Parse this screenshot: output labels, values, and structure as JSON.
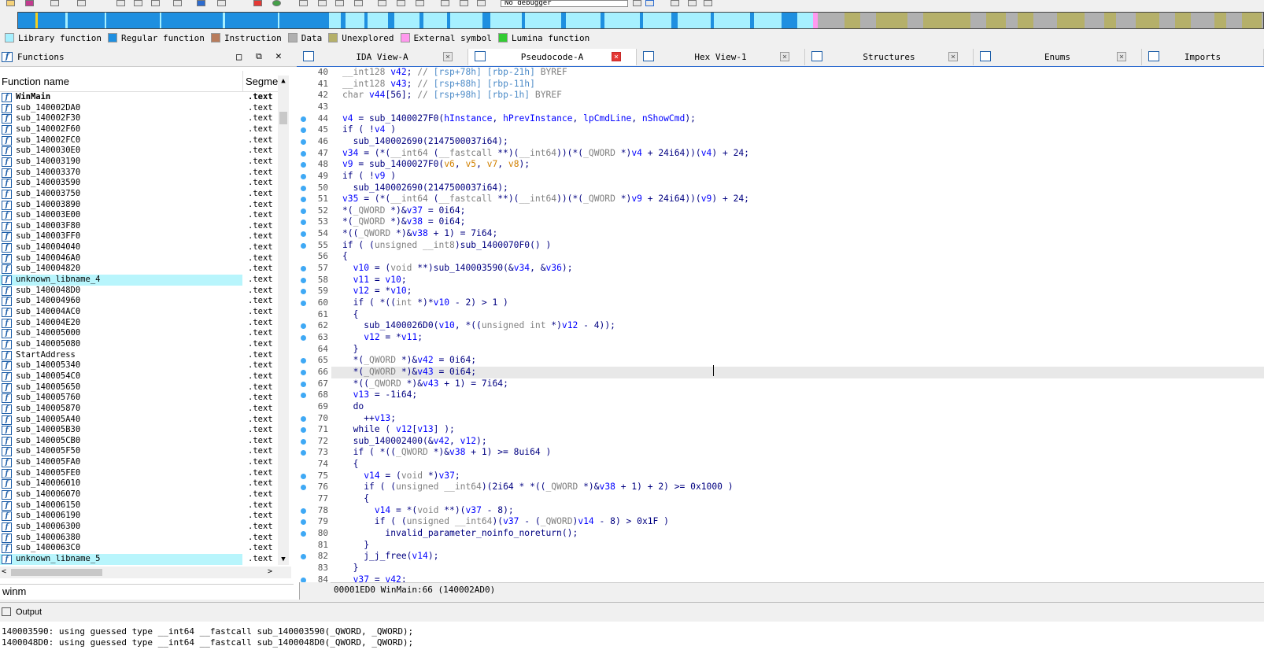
{
  "toolbar": {
    "debugger_select": "No debugger"
  },
  "legend": [
    {
      "label": "Library function",
      "color": "#a6f0ff"
    },
    {
      "label": "Regular function",
      "color": "#1e8fe0"
    },
    {
      "label": "Instruction",
      "color": "#b87c5c"
    },
    {
      "label": "Data",
      "color": "#b0b0b0"
    },
    {
      "label": "Unexplored",
      "color": "#b5b06a"
    },
    {
      "label": "External symbol",
      "color": "#ff99ee"
    },
    {
      "label": "Lumina function",
      "color": "#33cc33"
    }
  ],
  "functions_panel": {
    "title": "Functions",
    "col_name": "Function name",
    "col_segment": "Segme",
    "rows": [
      {
        "name": "WinMain",
        "seg": ".text",
        "bold": true
      },
      {
        "name": "sub_140002DA0",
        "seg": ".text"
      },
      {
        "name": "sub_140002F30",
        "seg": ".text"
      },
      {
        "name": "sub_140002F60",
        "seg": ".text"
      },
      {
        "name": "sub_140002FC0",
        "seg": ".text"
      },
      {
        "name": "sub_1400030E0",
        "seg": ".text"
      },
      {
        "name": "sub_140003190",
        "seg": ".text"
      },
      {
        "name": "sub_140003370",
        "seg": ".text"
      },
      {
        "name": "sub_140003590",
        "seg": ".text"
      },
      {
        "name": "sub_140003750",
        "seg": ".text"
      },
      {
        "name": "sub_140003890",
        "seg": ".text"
      },
      {
        "name": "sub_140003E00",
        "seg": ".text"
      },
      {
        "name": "sub_140003F80",
        "seg": ".text"
      },
      {
        "name": "sub_140003FF0",
        "seg": ".text"
      },
      {
        "name": "sub_140004040",
        "seg": ".text"
      },
      {
        "name": "sub_1400046A0",
        "seg": ".text"
      },
      {
        "name": "sub_140004820",
        "seg": ".text"
      },
      {
        "name": "unknown_libname_4",
        "seg": ".text",
        "lib": true
      },
      {
        "name": "sub_1400048D0",
        "seg": ".text"
      },
      {
        "name": "sub_140004960",
        "seg": ".text"
      },
      {
        "name": "sub_140004AC0",
        "seg": ".text"
      },
      {
        "name": "sub_140004E20",
        "seg": ".text"
      },
      {
        "name": "sub_140005000",
        "seg": ".text"
      },
      {
        "name": "sub_140005080",
        "seg": ".text"
      },
      {
        "name": "StartAddress",
        "seg": ".text"
      },
      {
        "name": "sub_140005340",
        "seg": ".text"
      },
      {
        "name": "sub_1400054C0",
        "seg": ".text"
      },
      {
        "name": "sub_140005650",
        "seg": ".text"
      },
      {
        "name": "sub_140005760",
        "seg": ".text"
      },
      {
        "name": "sub_140005870",
        "seg": ".text"
      },
      {
        "name": "sub_140005A40",
        "seg": ".text"
      },
      {
        "name": "sub_140005B30",
        "seg": ".text"
      },
      {
        "name": "sub_140005CB0",
        "seg": ".text"
      },
      {
        "name": "sub_140005F50",
        "seg": ".text"
      },
      {
        "name": "sub_140005FA0",
        "seg": ".text"
      },
      {
        "name": "sub_140005FE0",
        "seg": ".text"
      },
      {
        "name": "sub_140006010",
        "seg": ".text"
      },
      {
        "name": "sub_140006070",
        "seg": ".text"
      },
      {
        "name": "sub_140006150",
        "seg": ".text"
      },
      {
        "name": "sub_140006190",
        "seg": ".text"
      },
      {
        "name": "sub_140006300",
        "seg": ".text"
      },
      {
        "name": "sub_140006380",
        "seg": ".text"
      },
      {
        "name": "sub_1400063C0",
        "seg": ".text"
      },
      {
        "name": "unknown_libname_5",
        "seg": ".text",
        "lib": true
      }
    ],
    "filter": "winm"
  },
  "tabs": [
    {
      "label": "IDA View-A",
      "active": false
    },
    {
      "label": "Pseudocode-A",
      "active": true
    },
    {
      "label": "Hex View-1",
      "active": false
    },
    {
      "label": "Structures",
      "active": false
    },
    {
      "label": "Enums",
      "active": false
    },
    {
      "label": "Imports",
      "active": false
    }
  ],
  "code_lines": [
    {
      "n": "40",
      "dot": false,
      "t": "__int128 v42; // [rsp+78h] [rbp-21h] BYREF"
    },
    {
      "n": "41",
      "dot": false,
      "t": "__int128 v43; // [rsp+88h] [rbp-11h]"
    },
    {
      "n": "42",
      "dot": false,
      "t": "char v44[56]; // [rsp+98h] [rbp-1h] BYREF"
    },
    {
      "n": "43",
      "dot": false,
      "t": ""
    },
    {
      "n": "44",
      "dot": true,
      "t": "v4 = sub_1400027F0(hInstance, hPrevInstance, lpCmdLine, nShowCmd);"
    },
    {
      "n": "45",
      "dot": true,
      "t": "if ( !v4 )"
    },
    {
      "n": "46",
      "dot": true,
      "t": "  sub_140002690(2147500037i64);"
    },
    {
      "n": "47",
      "dot": true,
      "t": "v34 = (*(__int64 (__fastcall **)(__int64))(*(_QWORD *)v4 + 24i64))(v4) + 24;"
    },
    {
      "n": "48",
      "dot": true,
      "t": "v9 = sub_1400027F0(v6, v5, v7, v8);"
    },
    {
      "n": "49",
      "dot": true,
      "t": "if ( !v9 )"
    },
    {
      "n": "50",
      "dot": true,
      "t": "  sub_140002690(2147500037i64);"
    },
    {
      "n": "51",
      "dot": true,
      "t": "v35 = (*(__int64 (__fastcall **)(__int64))(*(_QWORD *)v9 + 24i64))(v9) + 24;"
    },
    {
      "n": "52",
      "dot": true,
      "t": "*(_QWORD *)&v37 = 0i64;"
    },
    {
      "n": "53",
      "dot": true,
      "t": "*(_QWORD *)&v38 = 0i64;"
    },
    {
      "n": "54",
      "dot": true,
      "t": "*((_QWORD *)&v38 + 1) = 7i64;"
    },
    {
      "n": "55",
      "dot": true,
      "t": "if ( (unsigned __int8)sub_1400070F0() )"
    },
    {
      "n": "56",
      "dot": false,
      "t": "{"
    },
    {
      "n": "57",
      "dot": true,
      "t": "  v10 = (void **)sub_140003590(&v34, &v36);"
    },
    {
      "n": "58",
      "dot": true,
      "t": "  v11 = v10;"
    },
    {
      "n": "59",
      "dot": true,
      "t": "  v12 = *v10;"
    },
    {
      "n": "60",
      "dot": true,
      "t": "  if ( *((int *)*v10 - 2) > 1 )"
    },
    {
      "n": "61",
      "dot": false,
      "t": "  {"
    },
    {
      "n": "62",
      "dot": true,
      "t": "    sub_1400026D0(v10, *((unsigned int *)v12 - 4));"
    },
    {
      "n": "63",
      "dot": true,
      "t": "    v12 = *v11;"
    },
    {
      "n": "64",
      "dot": false,
      "t": "  }"
    },
    {
      "n": "65",
      "dot": true,
      "t": "  *(_QWORD *)&v42 = 0i64;"
    },
    {
      "n": "66",
      "dot": true,
      "t": "  *(_QWORD *)&v43 = 0i64;",
      "hl": true
    },
    {
      "n": "67",
      "dot": true,
      "t": "  *((_QWORD *)&v43 + 1) = 7i64;"
    },
    {
      "n": "68",
      "dot": true,
      "t": "  v13 = -1i64;"
    },
    {
      "n": "69",
      "dot": false,
      "t": "  do"
    },
    {
      "n": "70",
      "dot": true,
      "t": "    ++v13;"
    },
    {
      "n": "71",
      "dot": true,
      "t": "  while ( v12[v13] );"
    },
    {
      "n": "72",
      "dot": true,
      "t": "  sub_140002400(&v42, v12);"
    },
    {
      "n": "73",
      "dot": true,
      "t": "  if ( *((_QWORD *)&v38 + 1) >= 8ui64 )"
    },
    {
      "n": "74",
      "dot": false,
      "t": "  {"
    },
    {
      "n": "75",
      "dot": true,
      "t": "    v14 = (void *)v37;"
    },
    {
      "n": "76",
      "dot": true,
      "t": "    if ( (unsigned __int64)(2i64 * *((_QWORD *)&v38 + 1) + 2) >= 0x1000 )"
    },
    {
      "n": "77",
      "dot": false,
      "t": "    {"
    },
    {
      "n": "78",
      "dot": true,
      "t": "      v14 = *(void **)(v37 - 8);"
    },
    {
      "n": "79",
      "dot": true,
      "t": "      if ( (unsigned __int64)(v37 - (_QWORD)v14 - 8) > 0x1F )"
    },
    {
      "n": "80",
      "dot": true,
      "t": "        invalid_parameter_noinfo_noreturn();"
    },
    {
      "n": "81",
      "dot": false,
      "t": "    }"
    },
    {
      "n": "82",
      "dot": true,
      "t": "    j_j_free(v14);"
    },
    {
      "n": "83",
      "dot": false,
      "t": "  }"
    },
    {
      "n": "84",
      "dot": true,
      "t": "  v37 = v42;"
    }
  ],
  "status": "00001ED0 WinMain:66 (140002AD0)",
  "output": {
    "title": "Output",
    "lines": [
      "140003590: using guessed type __int64 __fastcall sub_140003590(_QWORD, _QWORD);",
      "1400048D0: using guessed type __int64 __fastcall sub_1400048D0(_QWORD, _QWORD);"
    ]
  }
}
